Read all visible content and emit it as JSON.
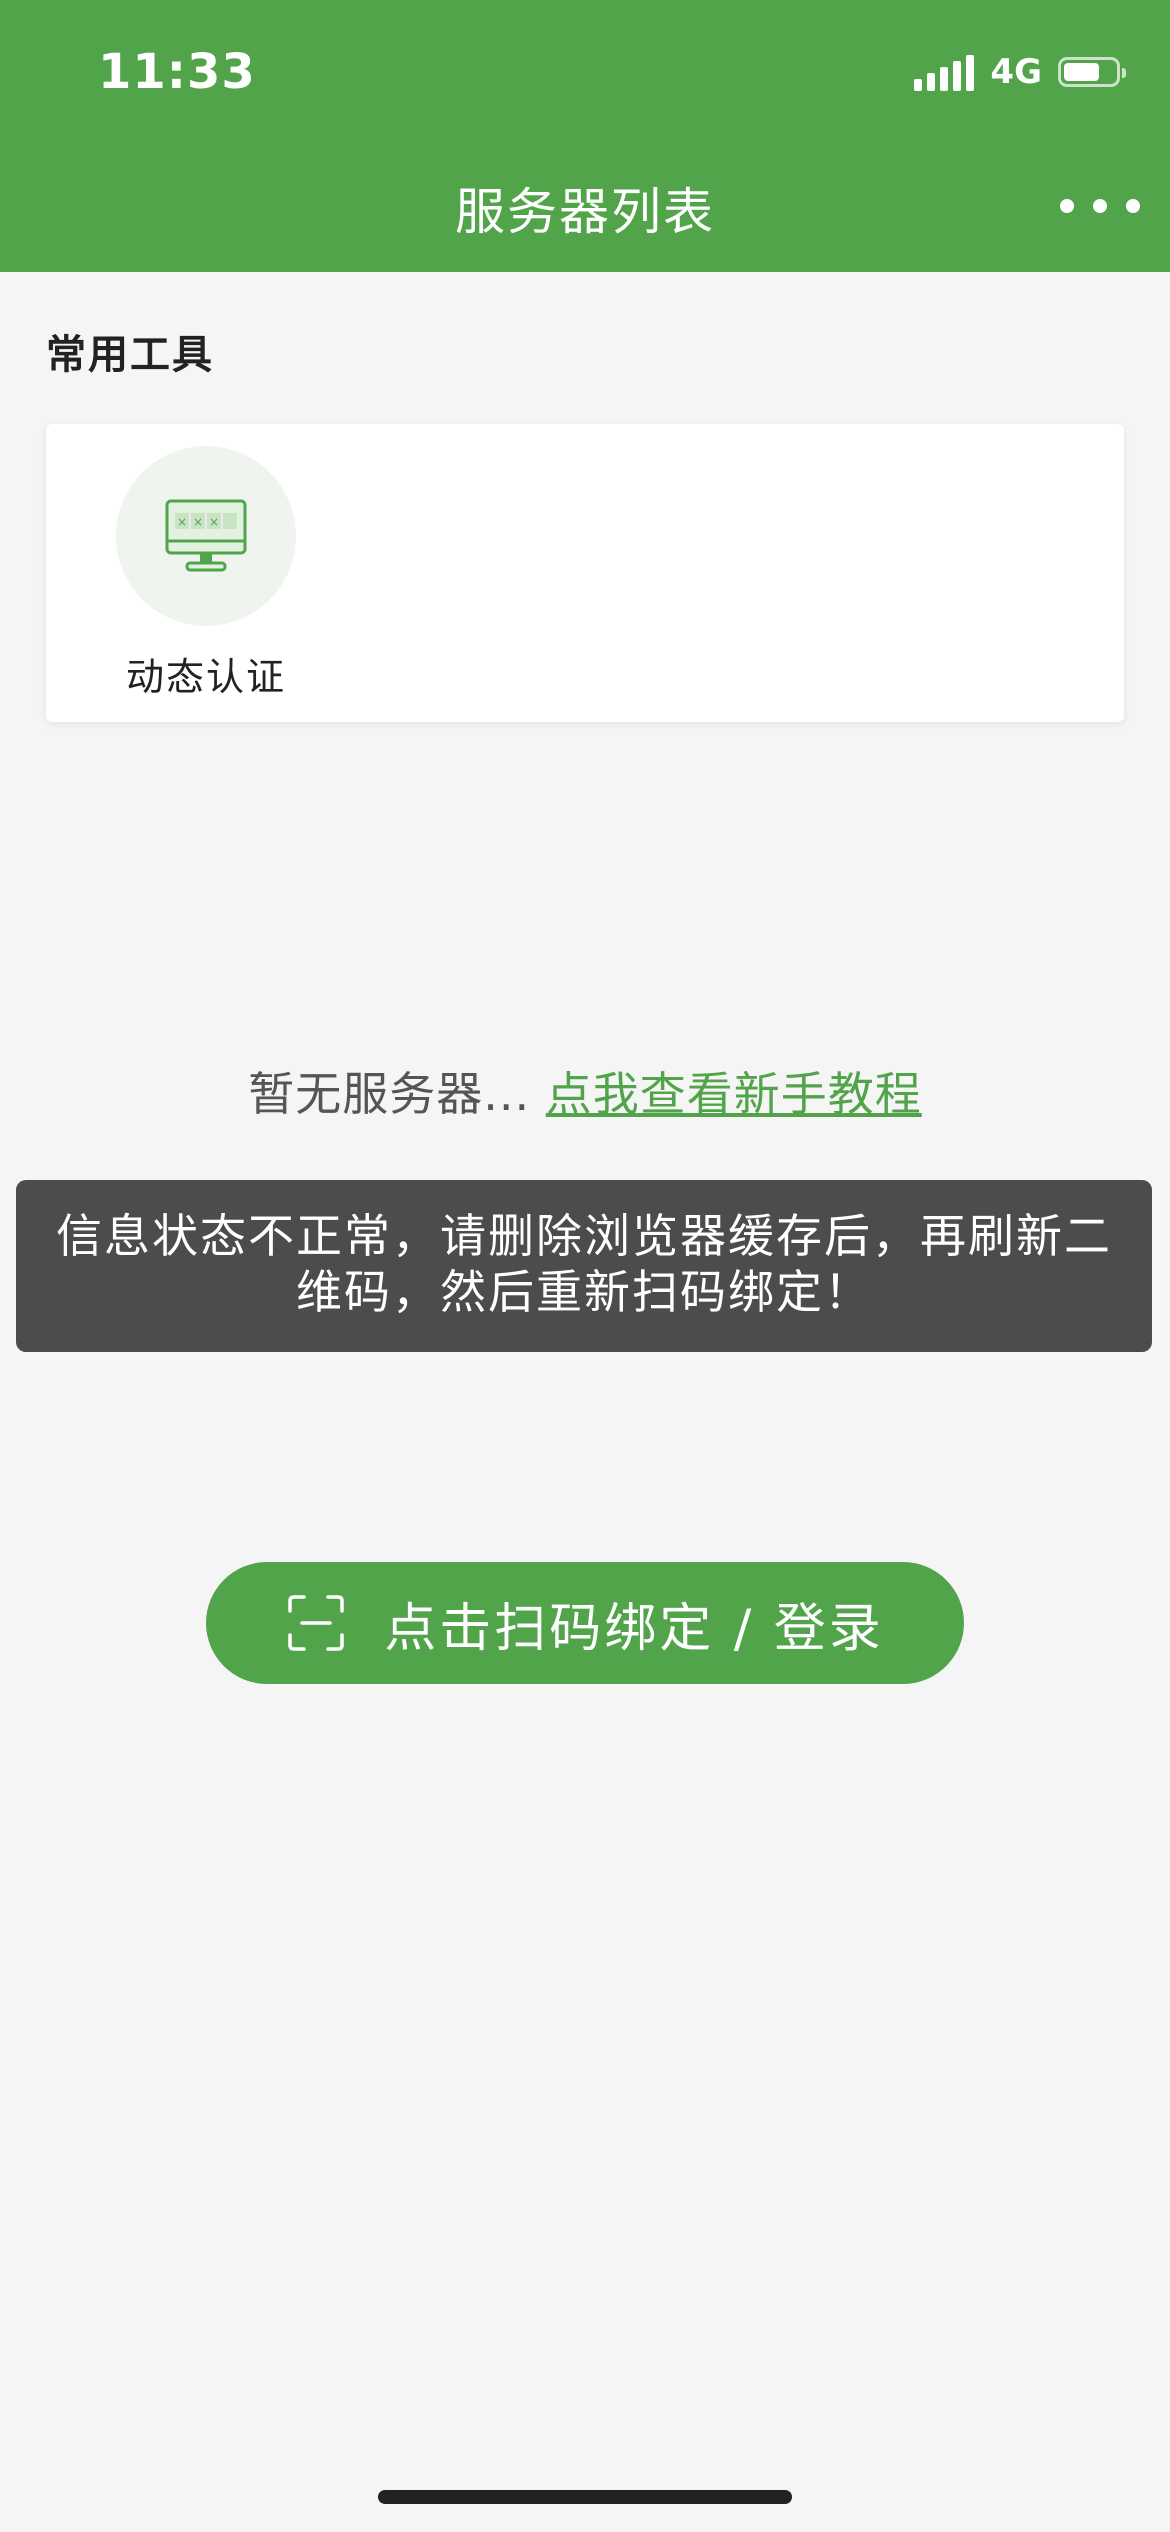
{
  "status_bar": {
    "time": "11:33",
    "network": "4G",
    "battery_level": 0.7
  },
  "nav": {
    "title": "服务器列表",
    "more_icon": "more-dots-icon"
  },
  "tools": {
    "section_title": "常用工具",
    "items": [
      {
        "label": "动态认证",
        "icon": "monitor-password-icon"
      }
    ]
  },
  "empty_state": {
    "text": "暂无服务器...",
    "link": "点我查看新手教程"
  },
  "toast": {
    "message": "信息状态不正常，请删除浏览器缓存后，再刷新二维码，然后重新扫码绑定！"
  },
  "scan_button": {
    "label": "点击扫码绑定 / 登录",
    "icon": "scan-icon"
  },
  "colors": {
    "brand": "#52a44b",
    "background": "#f5f5f5",
    "toast_background": "#4c4c4c"
  }
}
